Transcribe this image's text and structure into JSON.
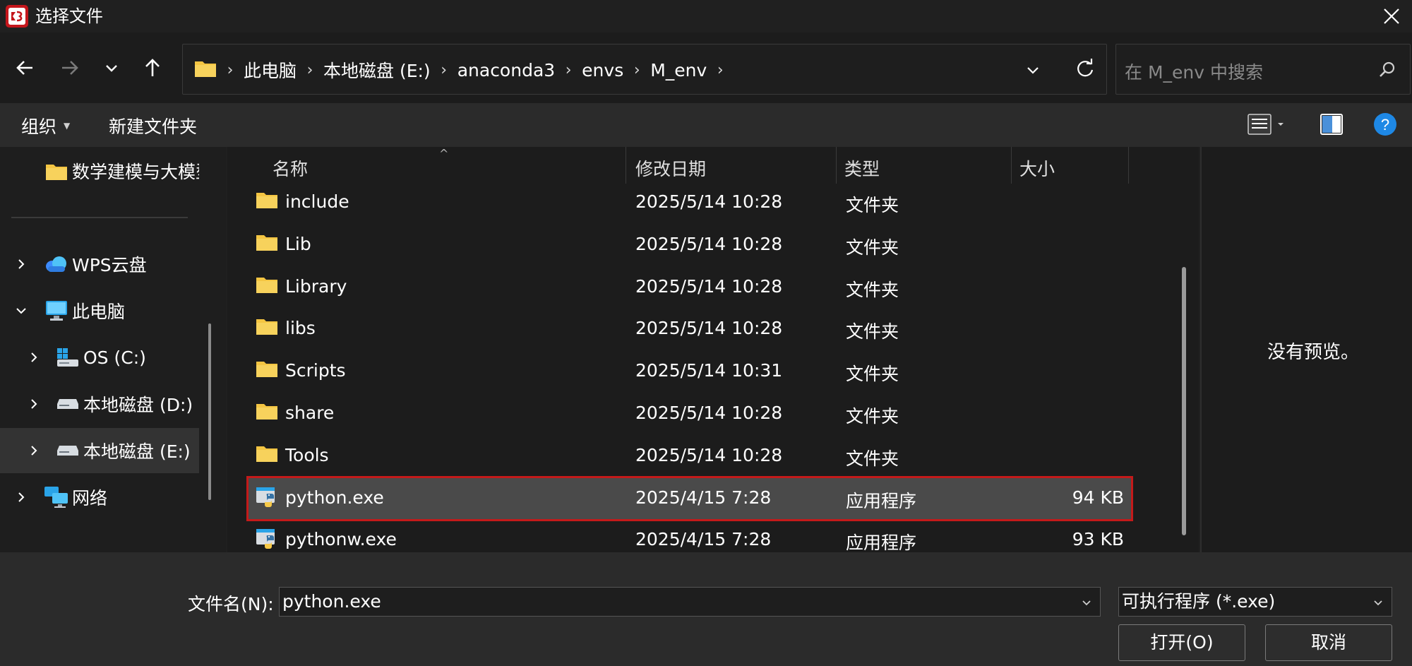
{
  "window": {
    "title": "选择文件"
  },
  "address": {
    "crumbs": [
      "此电脑",
      "本地磁盘 (E:)",
      "anaconda3",
      "envs",
      "M_env"
    ]
  },
  "search": {
    "placeholder": "在 M_env 中搜索"
  },
  "toolbar": {
    "organize": "组织",
    "new_folder": "新建文件夹"
  },
  "sidebar": {
    "items": [
      {
        "label": "数学建模与大模型",
        "icon": "folder-icon"
      },
      {
        "label": "WPS云盘",
        "icon": "cloud-icon"
      },
      {
        "label": "此电脑",
        "icon": "computer-icon"
      },
      {
        "label": "OS (C:)",
        "icon": "system-drive-icon"
      },
      {
        "label": "本地磁盘 (D:)",
        "icon": "drive-icon"
      },
      {
        "label": "本地磁盘 (E:)",
        "icon": "drive-icon"
      },
      {
        "label": "网络",
        "icon": "network-icon"
      }
    ]
  },
  "columns": {
    "name": "名称",
    "modified": "修改日期",
    "type": "类型",
    "size": "大小"
  },
  "files": [
    {
      "name": "include",
      "modified": "2025/5/14 10:28",
      "type": "文件夹",
      "size": ""
    },
    {
      "name": "Lib",
      "modified": "2025/5/14 10:28",
      "type": "文件夹",
      "size": ""
    },
    {
      "name": "Library",
      "modified": "2025/5/14 10:28",
      "type": "文件夹",
      "size": ""
    },
    {
      "name": "libs",
      "modified": "2025/5/14 10:28",
      "type": "文件夹",
      "size": ""
    },
    {
      "name": "Scripts",
      "modified": "2025/5/14 10:31",
      "type": "文件夹",
      "size": ""
    },
    {
      "name": "share",
      "modified": "2025/5/14 10:28",
      "type": "文件夹",
      "size": ""
    },
    {
      "name": "Tools",
      "modified": "2025/5/14 10:28",
      "type": "文件夹",
      "size": ""
    },
    {
      "name": "python.exe",
      "modified": "2025/4/15 7:28",
      "type": "应用程序",
      "size": "94 KB"
    },
    {
      "name": "pythonw.exe",
      "modified": "2025/4/15 7:28",
      "type": "应用程序",
      "size": "93 KB"
    }
  ],
  "preview": {
    "text": "没有预览。"
  },
  "footer": {
    "filename_label": "文件名(N):",
    "filename_value": "python.exe",
    "filter_value": "可执行程序 (*.exe)",
    "open_label": "打开(O)",
    "cancel_label": "取消"
  },
  "colors": {
    "selection_outline": "#c41a1a",
    "folder": "#f4c542",
    "help": "#1e88e5"
  }
}
